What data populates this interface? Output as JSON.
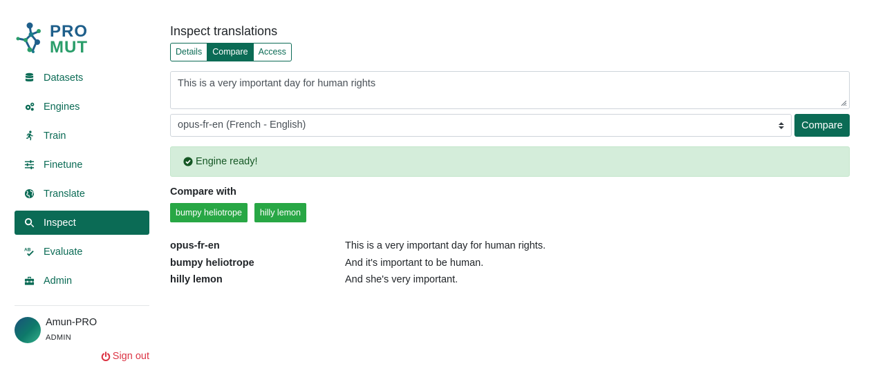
{
  "brand": {
    "line1": "PRO",
    "line2": "MUT"
  },
  "sidebar": {
    "items": [
      {
        "label": "Datasets",
        "icon": "database-icon",
        "active": false
      },
      {
        "label": "Engines",
        "icon": "cogs-icon",
        "active": false
      },
      {
        "label": "Train",
        "icon": "running-icon",
        "active": false
      },
      {
        "label": "Finetune",
        "icon": "sliders-icon",
        "active": false
      },
      {
        "label": "Translate",
        "icon": "globe-icon",
        "active": false
      },
      {
        "label": "Inspect",
        "icon": "search-icon",
        "active": true
      },
      {
        "label": "Evaluate",
        "icon": "spell-check-icon",
        "active": false
      },
      {
        "label": "Admin",
        "icon": "toolbox-icon",
        "active": false
      }
    ]
  },
  "user": {
    "name": "Amun-PRO",
    "role": "ADMIN",
    "signout": "Sign out"
  },
  "page": {
    "title": "Inspect translations",
    "tabs": [
      {
        "label": "Details",
        "active": false
      },
      {
        "label": "Compare",
        "active": true
      },
      {
        "label": "Access",
        "active": false
      }
    ],
    "source_text": "This is a very important day for human rights",
    "engine_select": "opus-fr-en (French - English)",
    "compare_button": "Compare",
    "alert": "Engine ready!",
    "compare_with_label": "Compare with",
    "compare_engines": [
      "bumpy heliotrope",
      "hilly lemon"
    ],
    "results": [
      {
        "engine": "opus-fr-en",
        "text": "This is a very important day for human rights."
      },
      {
        "engine": "bumpy heliotrope",
        "text": "And it's important to be human."
      },
      {
        "engine": "hilly lemon",
        "text": "And she's very important."
      }
    ]
  },
  "colors": {
    "primary": "#0b6b55",
    "chip": "#28a745",
    "alert_bg": "#d4edda",
    "danger": "#dc3545",
    "logo_blue": "#1f5f8b",
    "logo_green": "#2a9d6a"
  }
}
